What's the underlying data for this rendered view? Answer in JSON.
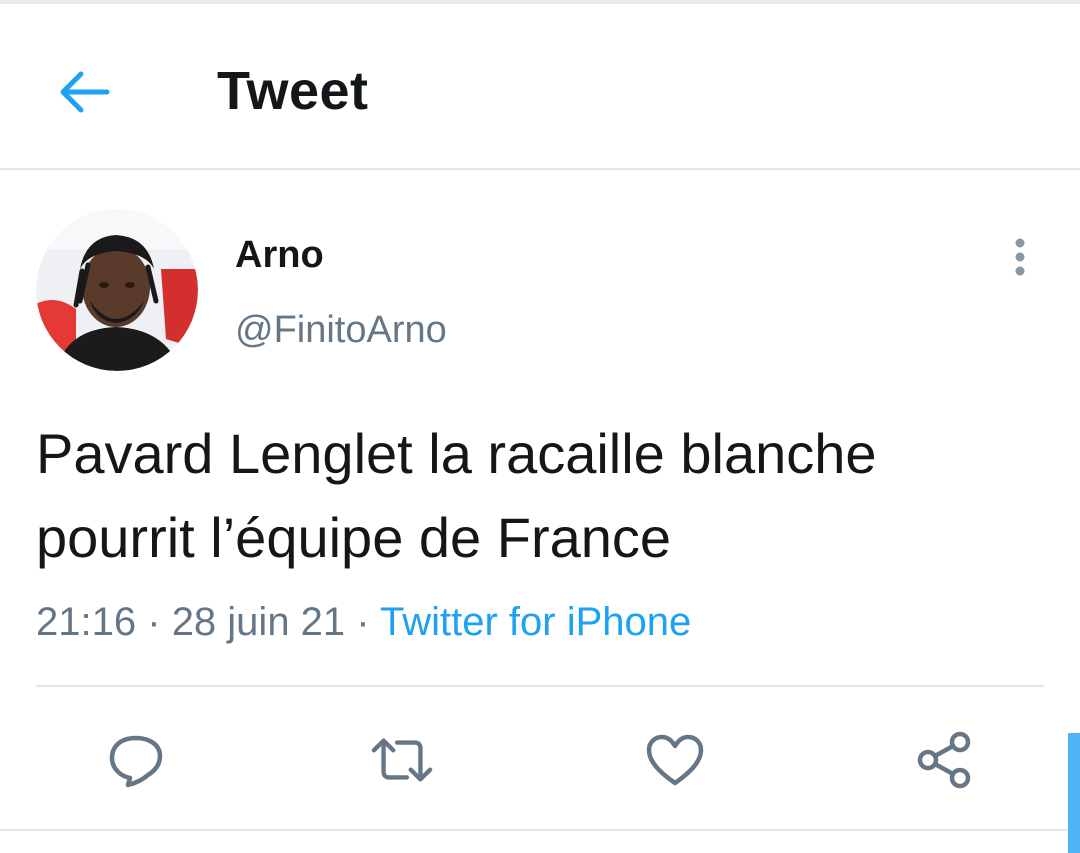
{
  "header": {
    "title": "Tweet",
    "back_icon": "arrow-left-icon"
  },
  "tweet": {
    "author": {
      "name": "Arno",
      "handle": "@FinitoArno"
    },
    "text": "Pavard Lenglet la racaille blanche pourrit l’équipe de France",
    "time": "21:16",
    "date": "28 juin 21",
    "separator": "·",
    "source": "Twitter for iPhone"
  },
  "actions": [
    {
      "icon": "reply-icon"
    },
    {
      "icon": "retweet-icon"
    },
    {
      "icon": "like-icon"
    },
    {
      "icon": "share-icon"
    }
  ],
  "colors": {
    "accent": "#1da1f2",
    "text_primary": "#14171a",
    "text_secondary": "#657786",
    "divider": "#e1e8ed"
  }
}
